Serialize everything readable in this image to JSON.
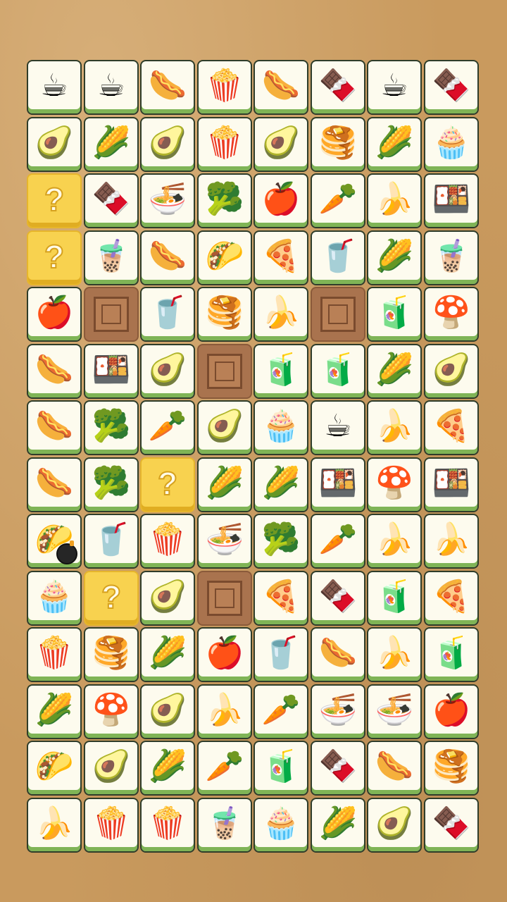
{
  "board": {
    "rows": [
      [
        "coffee",
        "coffee",
        "sausage",
        "popcorn",
        "sausage",
        "chocolate",
        "coffee",
        "chocolate"
      ],
      [
        "avocado",
        "corn",
        "avocado",
        "popcorn",
        "avocado",
        "pancakes",
        "corn",
        "muffin"
      ],
      [
        "mystery",
        "chocolate",
        "ramen",
        "broccoli",
        "apple",
        "carrot",
        "banana",
        "bento"
      ],
      [
        "mystery",
        "bubble-tea",
        "sausage",
        "taco",
        "pizza",
        "soda",
        "corn",
        "bubble-tea"
      ],
      [
        "apple",
        "crate",
        "soda",
        "pancakes",
        "banana",
        "crate",
        "juice",
        "mushroom"
      ],
      [
        "sausage",
        "bento",
        "avocado",
        "crate",
        "juice",
        "juice",
        "corn",
        "avocado"
      ],
      [
        "sausage",
        "broccoli",
        "carrot",
        "avocado",
        "muffin",
        "coffee",
        "banana",
        "pizza"
      ],
      [
        "sausage",
        "broccoli",
        "mystery",
        "corn",
        "corn",
        "bento",
        "mushroom",
        "bento"
      ],
      [
        "taco",
        "soda",
        "popcorn",
        "ramen",
        "broccoli",
        "carrot",
        "banana",
        "banana"
      ],
      [
        "muffin",
        "mystery",
        "avocado",
        "crate",
        "pizza",
        "chocolate",
        "juice",
        "pizza"
      ],
      [
        "popcorn",
        "pancakes",
        "corn",
        "apple",
        "soda",
        "sausage",
        "banana",
        "juice"
      ],
      [
        "corn",
        "mushroom",
        "avocado",
        "banana",
        "carrot",
        "ramen",
        "ramen",
        "apple"
      ],
      [
        "taco",
        "avocado",
        "corn",
        "carrot",
        "juice",
        "chocolate",
        "sausage",
        "pancakes"
      ],
      [
        "banana",
        "popcorn",
        "popcorn",
        "bubble-tea",
        "muffin",
        "corn",
        "avocado",
        "chocolate"
      ]
    ],
    "bomb": {
      "row": 8,
      "col": 0
    }
  },
  "glyphs": {
    "coffee": "☕",
    "sausage": "🌭",
    "popcorn": "🍿",
    "chocolate": "🍫",
    "avocado": "🥑",
    "corn": "🌽",
    "pancakes": "🥞",
    "muffin": "🧁",
    "ramen": "🍜",
    "broccoli": "🥦",
    "apple": "🍎",
    "carrot": "🥕",
    "banana": "🍌",
    "bento": "🍱",
    "bubble-tea": "🧋",
    "taco": "🌮",
    "pizza": "🍕",
    "soda": "🥤",
    "juice": "🧃",
    "mushroom": "🍄",
    "mystery": "?"
  },
  "colors": {
    "tile_face": "#fdfbee",
    "tile_base": "#7fb456",
    "mystery": "#f8d24f",
    "crate": "#a9734e",
    "table": "#c99a5e"
  }
}
